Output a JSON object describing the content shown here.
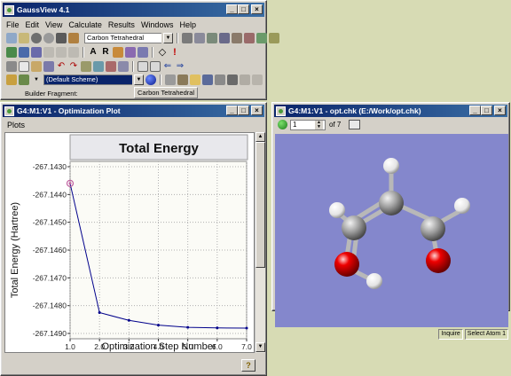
{
  "main_window": {
    "title": "GaussView 4.1",
    "menu": [
      "File",
      "Edit",
      "View",
      "Calculate",
      "Results",
      "Windows",
      "Help"
    ],
    "fragment_combo_value": "Carbon Tetrahedral",
    "scheme_combo_value": "(Default Scheme)",
    "builder_fragment_label": "Builder Fragment:",
    "builder_fragment_value": "Carbon Tetrahedral"
  },
  "plot_window": {
    "title": "G4:M1:V1 - Optimization Plot",
    "menu": [
      "Plots"
    ]
  },
  "viewer_window": {
    "title": "G4:M1:V1 - opt.chk (E:/Work/opt.chk)",
    "frame_value": "1",
    "frame_total": "of 7",
    "status_left": "Inquire",
    "status_right": "Select Atom 1"
  },
  "chart_data": {
    "type": "line",
    "title": "Total Energy",
    "xlabel": "Optimization Step Number",
    "ylabel": "Total Energy (Hartree)",
    "x_ticks": [
      "1.0",
      "2.0",
      "3.0",
      "4.0",
      "5.0",
      "6.0",
      "7.0"
    ],
    "y_ticks": [
      "-267.1430",
      "-267.1440",
      "-267.1450",
      "-267.1460",
      "-267.1470",
      "-267.1480",
      "-267.1490"
    ],
    "xlim": [
      1.0,
      7.0
    ],
    "ylim": [
      -267.149,
      -267.143
    ],
    "grid": true,
    "x": [
      1,
      2,
      3,
      4,
      5,
      6,
      7
    ],
    "y": [
      -267.1436,
      -267.14825,
      -267.14853,
      -267.1487,
      -267.14878,
      -267.1488,
      -267.14881
    ],
    "line_color": "#00008b",
    "highlight_point_index": 0,
    "highlight_color": "#c060a0"
  },
  "molecule": {
    "background": "#8487cc",
    "carbon_color": "#9a9a9a",
    "oxygen_color": "#e00000",
    "hydrogen_color": "#f4f4f4"
  }
}
